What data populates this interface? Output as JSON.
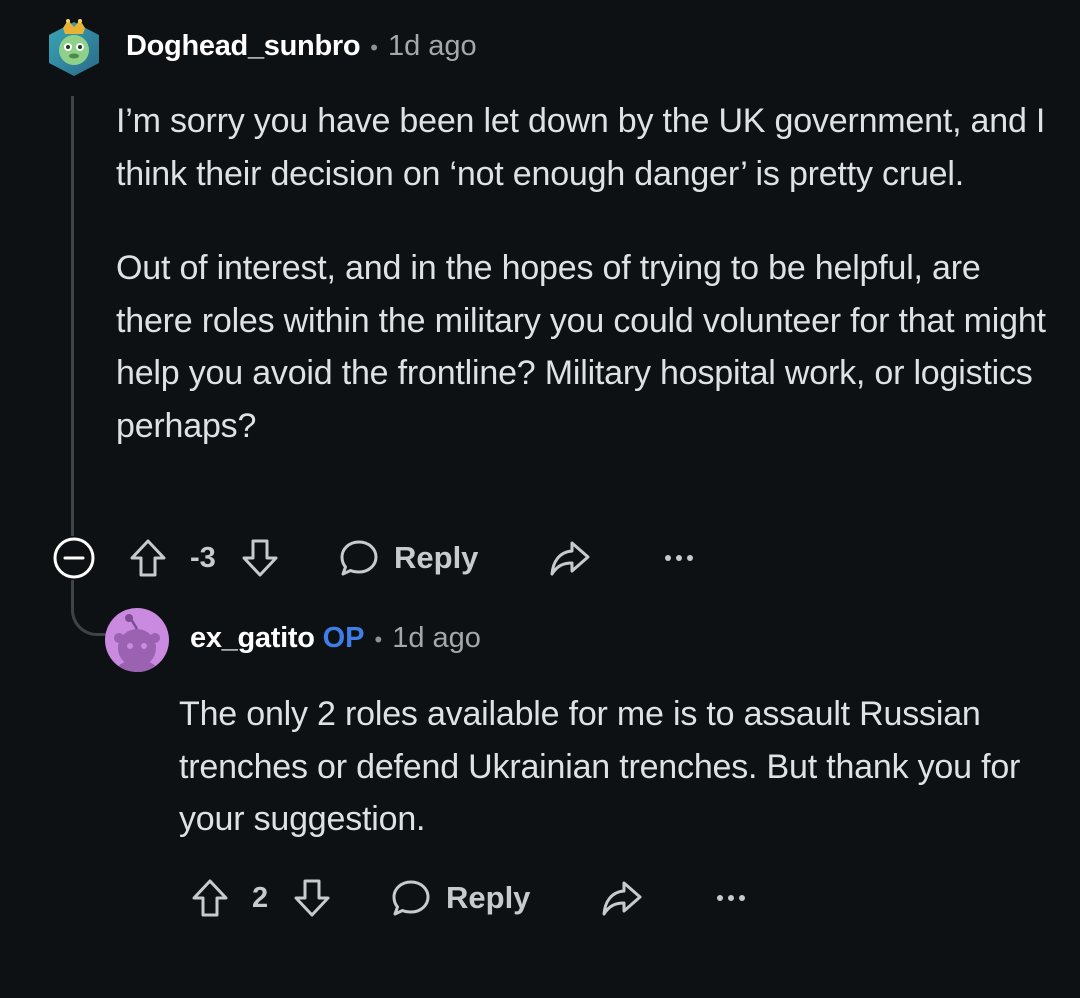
{
  "comments": [
    {
      "username": "Doghead_sunbro",
      "separator": "•",
      "time": "1d ago",
      "paragraphs": [
        "I’m sorry you have been let down by the UK government, and I think their decision on ‘not enough danger’ is pretty cruel.",
        "Out of interest, and in the hopes of trying to be helpful, are there roles within the military you could volunteer for that might help you avoid the frontline? Military hospital work, or logistics perhaps?"
      ],
      "score": "-3",
      "reply_label": "Reply",
      "more": "•••"
    },
    {
      "username": "ex_gatito",
      "op_tag": "OP",
      "separator": "•",
      "time": "1d ago",
      "paragraphs": [
        "The only 2 roles available for me is to assault Russian trenches or defend Ukrainian trenches. But thank you for your suggestion."
      ],
      "score": "2",
      "reply_label": "Reply",
      "more": "•••"
    }
  ],
  "colors": {
    "background": "#0e1113",
    "op_accent": "#3f7de8",
    "thread_line": "#3e4346",
    "avatar2_bg": "#c98ae0"
  },
  "icons": [
    "snoo-avatar-icon",
    "collapse-icon",
    "upvote-icon",
    "downvote-icon",
    "comment-bubble-icon",
    "share-icon",
    "more-options-icon"
  ]
}
